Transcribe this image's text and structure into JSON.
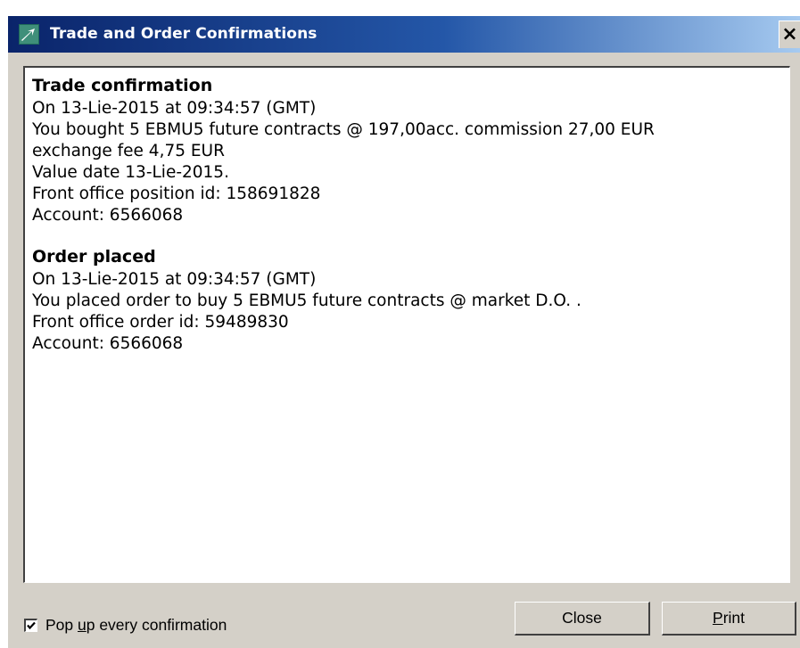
{
  "window": {
    "title": "Trade and Order Confirmations",
    "close_glyph": "×",
    "icon": "app-arrow-icon"
  },
  "trade": {
    "heading": "Trade confirmation",
    "lines": [
      "On 13-Lie-2015 at 09:34:57 (GMT)",
      "You bought 5 EBMU5 future contracts @ 197,00acc. commission 27,00 EUR",
      "exchange fee 4,75 EUR",
      "Value date 13-Lie-2015.",
      "Front office position id: 158691828",
      "Account: 6566068"
    ]
  },
  "order": {
    "heading": "Order placed",
    "lines": [
      "On 13-Lie-2015 at 09:34:57 (GMT)",
      "You placed order to buy 5 EBMU5 future contracts @ market D.O. .",
      "Front office order id: 59489830",
      "Account: 6566068"
    ]
  },
  "footer": {
    "checkbox_checked": true,
    "checkbox_label_pre": "Pop ",
    "checkbox_label_mnemonic": "u",
    "checkbox_label_post": "p every confirmation",
    "close_label": "Close",
    "print_label_mnemonic": "P",
    "print_label_rest": "rint"
  }
}
